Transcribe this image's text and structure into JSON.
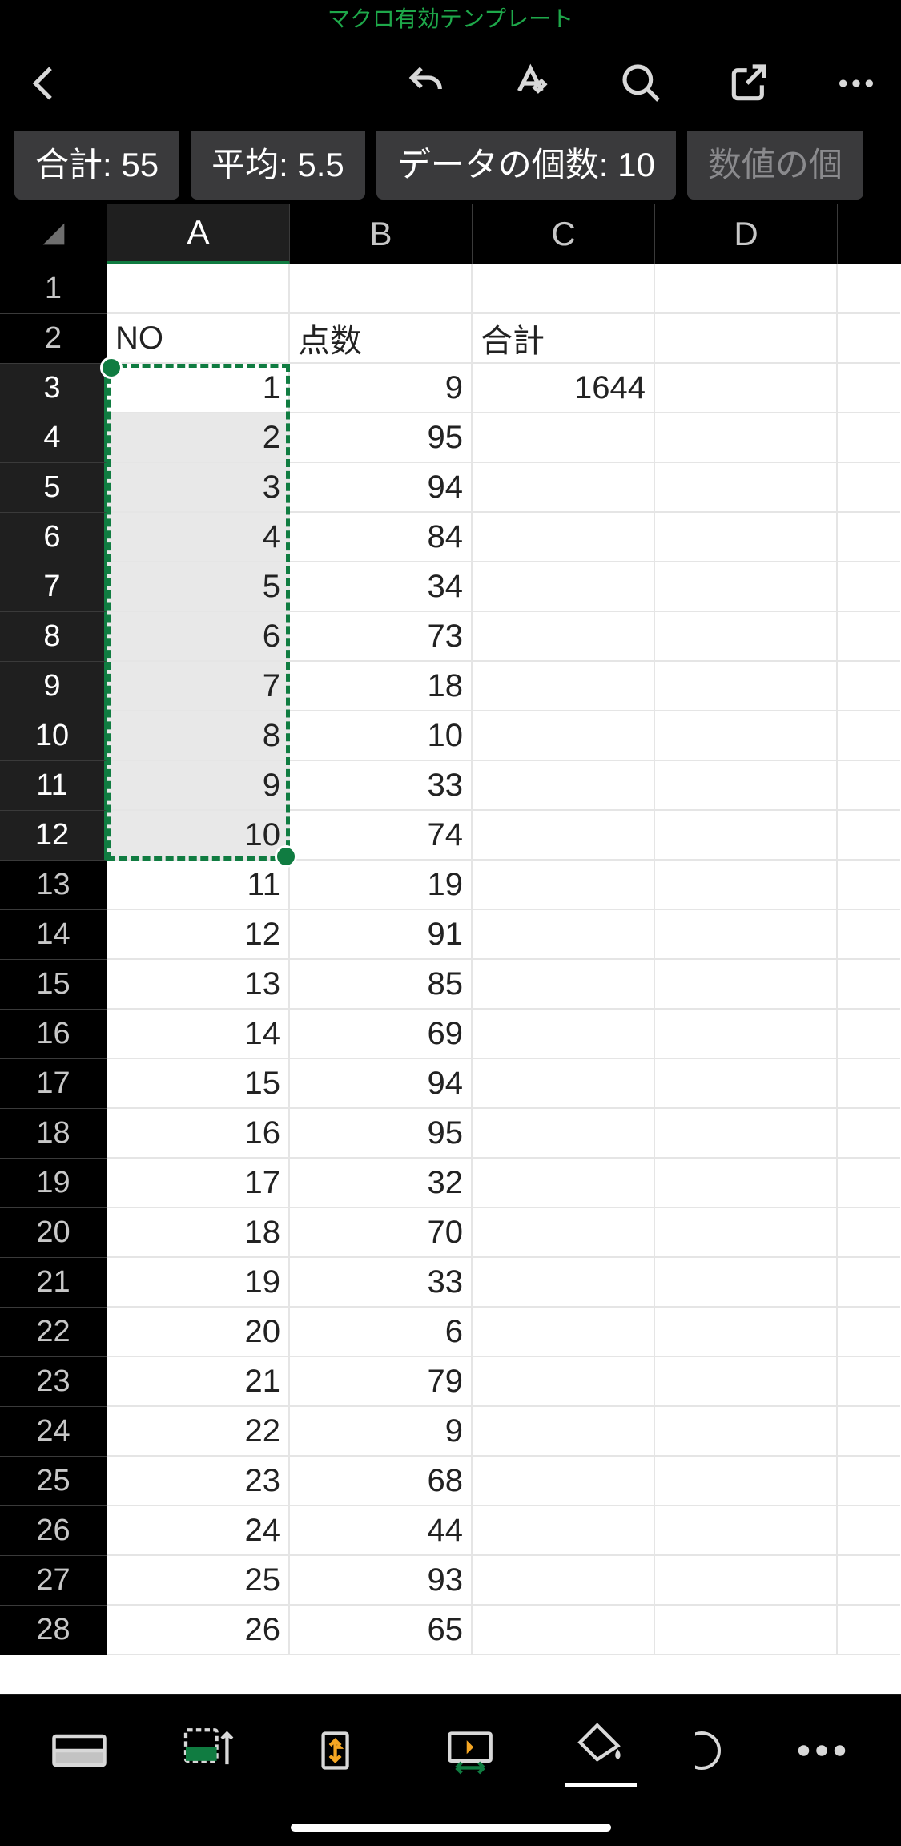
{
  "title": "マクロ有効テンプレート",
  "stats": {
    "sum": "合計: 55",
    "avg": "平均: 5.5",
    "count": "データの個数: 10",
    "numcount": "数値の個"
  },
  "columns": [
    "A",
    "B",
    "C",
    "D"
  ],
  "selected_col_index": 0,
  "selected_row_start": 3,
  "selected_row_end": 12,
  "headers_row": {
    "a": "NO",
    "b": "点数",
    "c": "合計"
  },
  "rows": [
    {
      "n": "1",
      "a": "",
      "b": "",
      "c": ""
    },
    {
      "n": "2",
      "a": "NO",
      "b": "点数",
      "c": "合計",
      "textA": true,
      "textB": true,
      "textC": true
    },
    {
      "n": "3",
      "a": "1",
      "b": "9",
      "c": "1644"
    },
    {
      "n": "4",
      "a": "2",
      "b": "95",
      "c": ""
    },
    {
      "n": "5",
      "a": "3",
      "b": "94",
      "c": ""
    },
    {
      "n": "6",
      "a": "4",
      "b": "84",
      "c": ""
    },
    {
      "n": "7",
      "a": "5",
      "b": "34",
      "c": ""
    },
    {
      "n": "8",
      "a": "6",
      "b": "73",
      "c": ""
    },
    {
      "n": "9",
      "a": "7",
      "b": "18",
      "c": ""
    },
    {
      "n": "10",
      "a": "8",
      "b": "10",
      "c": ""
    },
    {
      "n": "11",
      "a": "9",
      "b": "33",
      "c": ""
    },
    {
      "n": "12",
      "a": "10",
      "b": "74",
      "c": ""
    },
    {
      "n": "13",
      "a": "11",
      "b": "19",
      "c": ""
    },
    {
      "n": "14",
      "a": "12",
      "b": "91",
      "c": ""
    },
    {
      "n": "15",
      "a": "13",
      "b": "85",
      "c": ""
    },
    {
      "n": "16",
      "a": "14",
      "b": "69",
      "c": ""
    },
    {
      "n": "17",
      "a": "15",
      "b": "94",
      "c": ""
    },
    {
      "n": "18",
      "a": "16",
      "b": "95",
      "c": ""
    },
    {
      "n": "19",
      "a": "17",
      "b": "32",
      "c": ""
    },
    {
      "n": "20",
      "a": "18",
      "b": "70",
      "c": ""
    },
    {
      "n": "21",
      "a": "19",
      "b": "33",
      "c": ""
    },
    {
      "n": "22",
      "a": "20",
      "b": "6",
      "c": ""
    },
    {
      "n": "23",
      "a": "21",
      "b": "79",
      "c": ""
    },
    {
      "n": "24",
      "a": "22",
      "b": "9",
      "c": ""
    },
    {
      "n": "25",
      "a": "23",
      "b": "68",
      "c": ""
    },
    {
      "n": "26",
      "a": "24",
      "b": "44",
      "c": ""
    },
    {
      "n": "27",
      "a": "25",
      "b": "93",
      "c": ""
    },
    {
      "n": "28",
      "a": "26",
      "b": "65",
      "c": ""
    }
  ]
}
